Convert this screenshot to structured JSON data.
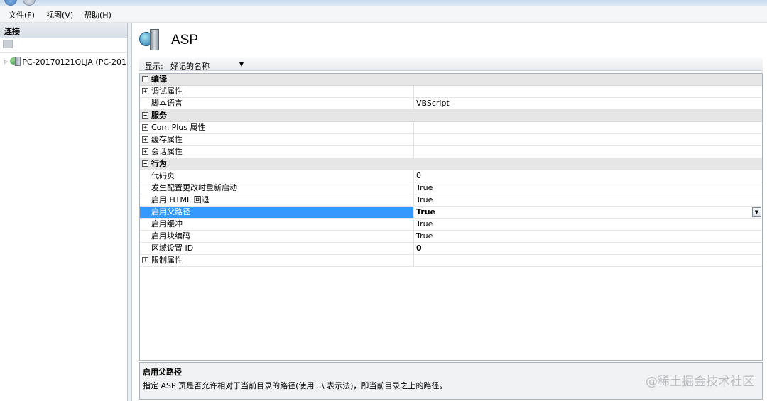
{
  "menu": [
    "文件(F)",
    "视图(V)",
    "帮助(H)"
  ],
  "connections": {
    "header": "连接",
    "server_node": "PC-20170121QLJA (PC-201"
  },
  "page": {
    "title": "ASP"
  },
  "display": {
    "label": "显示:",
    "value": "好记的名称"
  },
  "grid": {
    "rows": [
      {
        "type": "category",
        "name": "编译",
        "toggle": "−"
      },
      {
        "type": "subcat",
        "name": "调试属性",
        "toggle": "+",
        "value": ""
      },
      {
        "type": "prop",
        "name": "脚本语言",
        "value": "VBScript"
      },
      {
        "type": "category",
        "name": "服务",
        "toggle": "−"
      },
      {
        "type": "subcat",
        "name": "Com Plus 属性",
        "toggle": "+",
        "value": ""
      },
      {
        "type": "subcat",
        "name": "缓存属性",
        "toggle": "+",
        "value": ""
      },
      {
        "type": "subcat",
        "name": "会话属性",
        "toggle": "+",
        "value": ""
      },
      {
        "type": "category",
        "name": "行为",
        "toggle": "−"
      },
      {
        "type": "prop",
        "name": "代码页",
        "value": "0"
      },
      {
        "type": "prop",
        "name": "发生配置更改时重新启动",
        "value": "True"
      },
      {
        "type": "prop",
        "name": "启用 HTML 回退",
        "value": "True"
      },
      {
        "type": "prop",
        "name": "启用父路径",
        "value": "True",
        "selected": true
      },
      {
        "type": "prop",
        "name": "启用缓冲",
        "value": "True"
      },
      {
        "type": "prop",
        "name": "启用块编码",
        "value": "True"
      },
      {
        "type": "prop",
        "name": "区域设置 ID",
        "value": "0",
        "bold": true
      },
      {
        "type": "subcat",
        "name": "限制属性",
        "toggle": "+",
        "value": ""
      }
    ]
  },
  "description": {
    "title": "启用父路径",
    "text": "指定 ASP 页是否允许相对于当前目录的路径(使用 ..\\ 表示法)，即当前目录之上的路径。"
  },
  "watermark": "@稀土掘金技术社区",
  "colors": {
    "selection": "#3399ff",
    "category_bg": "#e6e6e6"
  }
}
